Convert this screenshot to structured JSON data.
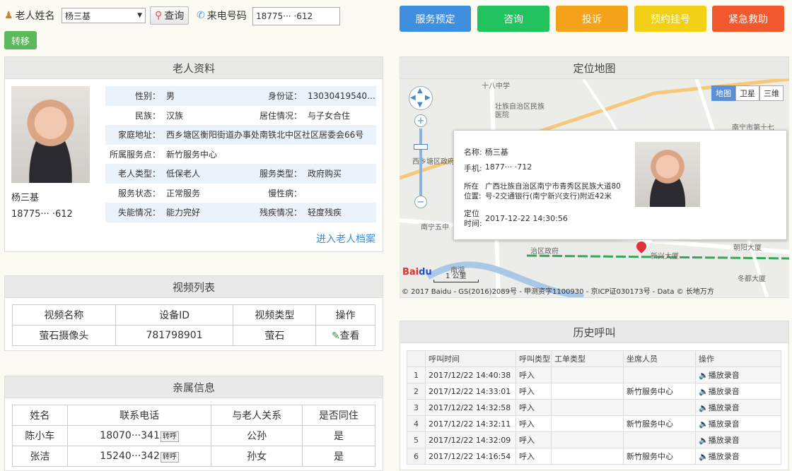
{
  "search": {
    "name_label": "老人姓名",
    "name_value": "杨三基",
    "query_label": "查询",
    "phone_label": "来电号码",
    "phone_value": "18775··· ·612",
    "transfer_label": "转移"
  },
  "actions": [
    {
      "label": "服务预定",
      "color": "#3f8fe0"
    },
    {
      "label": "咨询",
      "color": "#22c35e"
    },
    {
      "label": "投诉",
      "color": "#f5a31a"
    },
    {
      "label": "预约挂号",
      "color": "#f2d016"
    },
    {
      "label": "紧急救助",
      "color": "#f2582e"
    }
  ],
  "profile": {
    "title": "老人资料",
    "name": "杨三基",
    "phone": "18775··· ·612",
    "rows": [
      {
        "k1": "性别：",
        "v1": "男",
        "k2": "身份证：",
        "v2": "13030419540101..."
      },
      {
        "k1": "民族：",
        "v1": "汉族",
        "k2": "居住情况：",
        "v2": "与子女合住"
      },
      {
        "k1": "家庭地址：",
        "v1": "西乡塘区衡阳街道办事处南铁北中区社区居委会66号",
        "k2": "",
        "v2": ""
      },
      {
        "k1": "所属服务点：",
        "v1": "新竹服务中心",
        "k2": "",
        "v2": ""
      },
      {
        "k1": "老人类型：",
        "v1": "低保老人",
        "k2": "服务类型：",
        "v2": "政府购买"
      },
      {
        "k1": "服务状态：",
        "v1": "正常服务",
        "k2": "慢性病：",
        "v2": ""
      },
      {
        "k1": "失能情况：",
        "v1": "能力完好",
        "k2": "残疾情况：",
        "v2": "轻度残疾"
      }
    ],
    "archive_link": "进入老人档案"
  },
  "video": {
    "title": "视频列表",
    "headers": [
      "视频名称",
      "设备ID",
      "视频类型",
      "操作"
    ],
    "rows": [
      {
        "name": "萤石摄像头",
        "device": "781798901",
        "type": "萤石",
        "op": "查看"
      }
    ]
  },
  "relatives": {
    "title": "亲属信息",
    "headers": [
      "姓名",
      "联系电话",
      "与老人关系",
      "是否同住"
    ],
    "call_label": "转呼",
    "rows": [
      {
        "name": "陈小车",
        "phone": "18070···341",
        "relation": "公孙",
        "live": "是"
      },
      {
        "name": "张洁",
        "phone": "15240···342",
        "relation": "孙女",
        "live": "是"
      }
    ]
  },
  "map": {
    "title": "定位地图",
    "types": [
      "地图",
      "卫星",
      "三维"
    ],
    "labels": [
      "十八中学",
      "壮族自治区民族医院",
      "南宁市第十七",
      "西乡塘区政府",
      "南宁五中",
      "治区政府",
      "南湖",
      "朝阳大厦",
      "冬都大厦",
      "新兴大厦"
    ],
    "popup": {
      "name_label": "名称:",
      "name_value": "杨三基",
      "phone_label": "手机:",
      "phone_value": "1877··· ·712",
      "loc_label": "所在位置:",
      "loc_value": "广西壮族自治区南宁市青秀区民族大道80号-2交通银行(南宁新兴支行)附近42米",
      "time_label": "定位时间:",
      "time_value": "2017-12-22 14:30:56"
    },
    "scale": "1 公里",
    "copyright": "© 2017 Baidu - GS(2016)2089号 - 甲测资字1100930 - 京ICP证030173号 - Data © 长地万方"
  },
  "history": {
    "title": "历史呼叫",
    "headers": [
      "",
      "呼叫时间",
      "呼叫类型",
      "工单类型",
      "坐席人员",
      "操作"
    ],
    "play_label": "播放录音",
    "rows": [
      {
        "n": "1",
        "time": "2017/12/22 14:40:38",
        "type": "呼入",
        "order": "",
        "agent": ""
      },
      {
        "n": "2",
        "time": "2017/12/22 14:33:01",
        "type": "呼入",
        "order": "",
        "agent": "新竹服务中心"
      },
      {
        "n": "3",
        "time": "2017/12/22 14:32:58",
        "type": "呼入",
        "order": "",
        "agent": ""
      },
      {
        "n": "4",
        "time": "2017/12/22 14:32:11",
        "type": "呼入",
        "order": "",
        "agent": "新竹服务中心"
      },
      {
        "n": "5",
        "time": "2017/12/22 14:32:09",
        "type": "呼入",
        "order": "",
        "agent": ""
      },
      {
        "n": "6",
        "time": "2017/12/22 14:16:54",
        "type": "呼入",
        "order": "",
        "agent": "新竹服务中心"
      }
    ]
  }
}
